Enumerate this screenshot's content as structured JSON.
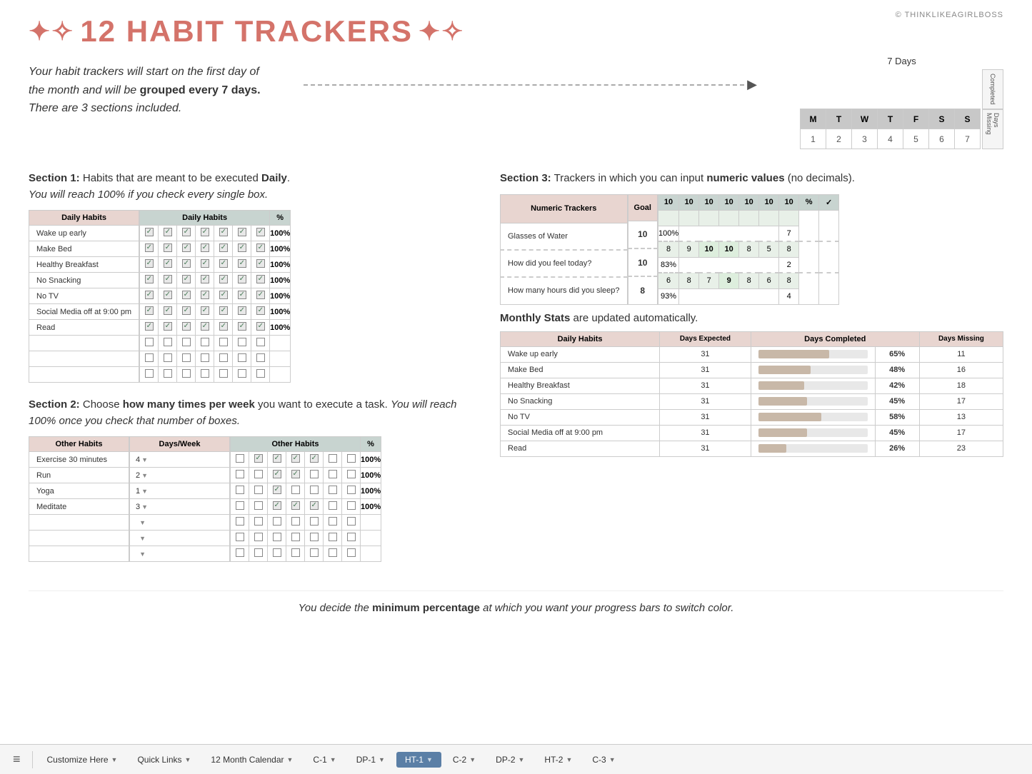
{
  "copyright": "© THINKLIKEAGIRLBOSS",
  "title": "12 HABIT TRACKERS",
  "intro": {
    "text_line1": "Your habit trackers will start on the first day of",
    "text_line2": "the month and will be",
    "text_bold": "grouped every 7 days.",
    "text_line3": "There are 3 sections included."
  },
  "days_table": {
    "label": "7 Days",
    "headers": [
      "M",
      "T",
      "W",
      "T",
      "F",
      "S",
      "S"
    ],
    "values": [
      "1",
      "2",
      "3",
      "4",
      "5",
      "6",
      "7"
    ],
    "side_labels": [
      "Completed",
      "Days Missing"
    ]
  },
  "section1": {
    "label": "Section 1:",
    "desc": "Habits that are meant to be executed",
    "bold": "Daily",
    "sub": "You will reach 100% if you check every single box.",
    "table_header": "Daily Habits",
    "check_header": "Daily Habits",
    "habits": [
      {
        "name": "Wake up early",
        "pct": "100%"
      },
      {
        "name": "Make Bed",
        "pct": "100%"
      },
      {
        "name": "Healthy Breakfast",
        "pct": "100%"
      },
      {
        "name": "No Snacking",
        "pct": "100%"
      },
      {
        "name": "No TV",
        "pct": "100%"
      },
      {
        "name": "Social Media off at 9:00 pm",
        "pct": "100%"
      },
      {
        "name": "Read",
        "pct": "100%"
      },
      {
        "name": ""
      },
      {
        "name": ""
      },
      {
        "name": ""
      }
    ]
  },
  "section2": {
    "label": "Section 2:",
    "desc": "Choose",
    "bold": "how many times per week",
    "desc2": "you want to execute a task.",
    "italic": "You will reach 100% once you check that number of boxes.",
    "table_header": "Other Habits",
    "days_week_header": "Days/Week",
    "check_header": "Other Habits",
    "habits": [
      {
        "name": "Exercise 30 minutes",
        "days": "4",
        "pct": "100%"
      },
      {
        "name": "Run",
        "days": "2",
        "pct": "100%"
      },
      {
        "name": "Yoga",
        "days": "1",
        "pct": "100%"
      },
      {
        "name": "Meditate",
        "days": "3",
        "pct": "100%"
      },
      {
        "name": "",
        "days": ""
      },
      {
        "name": "",
        "days": ""
      },
      {
        "name": "",
        "days": ""
      }
    ]
  },
  "section3": {
    "label": "Section 3:",
    "desc": "Trackers in which you can input",
    "bold": "numeric values",
    "desc2": "(no decimals).",
    "table_header": "Numeric Trackers",
    "check_header": "Numeric Trackers",
    "goal_label": "Goal",
    "trackers": [
      {
        "name": "Glasses of Water",
        "goal": "10",
        "values": [
          "10",
          "10",
          "10",
          "10",
          "10",
          "10",
          "10"
        ],
        "pct": "100%",
        "missing": "7"
      },
      {
        "name": "How did you feel today?",
        "goal": "10",
        "values": [
          "8",
          "9",
          "10",
          "10",
          "8",
          "5",
          "8"
        ],
        "pct": "83%",
        "missing": "2"
      },
      {
        "name": "How many hours did you sleep?",
        "goal": "8",
        "values": [
          "6",
          "8",
          "7",
          "9",
          "8",
          "6",
          "8"
        ],
        "pct": "93%",
        "missing": "4"
      }
    ]
  },
  "monthly_stats": {
    "label": "Monthly Stats",
    "desc": "are updated automatically.",
    "headers": [
      "Daily Habits",
      "Days Expected",
      "Days Completed",
      "Days Missing"
    ],
    "habits": [
      {
        "name": "Wake up early",
        "expected": "31",
        "completed": 20,
        "total": 31,
        "pct": "65%",
        "missing": "11"
      },
      {
        "name": "Make Bed",
        "expected": "31",
        "completed": 15,
        "total": 31,
        "pct": "48%",
        "missing": "16"
      },
      {
        "name": "Healthy Breakfast",
        "expected": "31",
        "completed": 13,
        "total": 31,
        "pct": "42%",
        "missing": "18"
      },
      {
        "name": "No Snacking",
        "expected": "31",
        "completed": 14,
        "total": 31,
        "pct": "45%",
        "missing": "17"
      },
      {
        "name": "No TV",
        "expected": "31",
        "completed": 18,
        "total": 31,
        "pct": "58%",
        "missing": "13"
      },
      {
        "name": "Social Media off at 9:00 pm",
        "expected": "31",
        "completed": 14,
        "total": 31,
        "pct": "45%",
        "missing": "17"
      },
      {
        "name": "Read",
        "expected": "31",
        "completed": 8,
        "total": 31,
        "pct": "26%",
        "missing": "23"
      }
    ]
  },
  "bottom_note": {
    "text1": "You decide the",
    "bold": "minimum percentage",
    "text2": "at which you want your progress bars to switch color."
  },
  "nav": {
    "menu_icon": "≡",
    "tabs": [
      {
        "label": "Customize Here",
        "active": false
      },
      {
        "label": "Quick Links",
        "active": false
      },
      {
        "label": "12 Month Calendar",
        "active": false
      },
      {
        "label": "C-1",
        "active": false
      },
      {
        "label": "DP-1",
        "active": false
      },
      {
        "label": "HT-1",
        "active": true
      },
      {
        "label": "C-2",
        "active": false
      },
      {
        "label": "DP-2",
        "active": false
      },
      {
        "label": "HT-2",
        "active": false
      },
      {
        "label": "C-3",
        "active": false
      }
    ]
  }
}
